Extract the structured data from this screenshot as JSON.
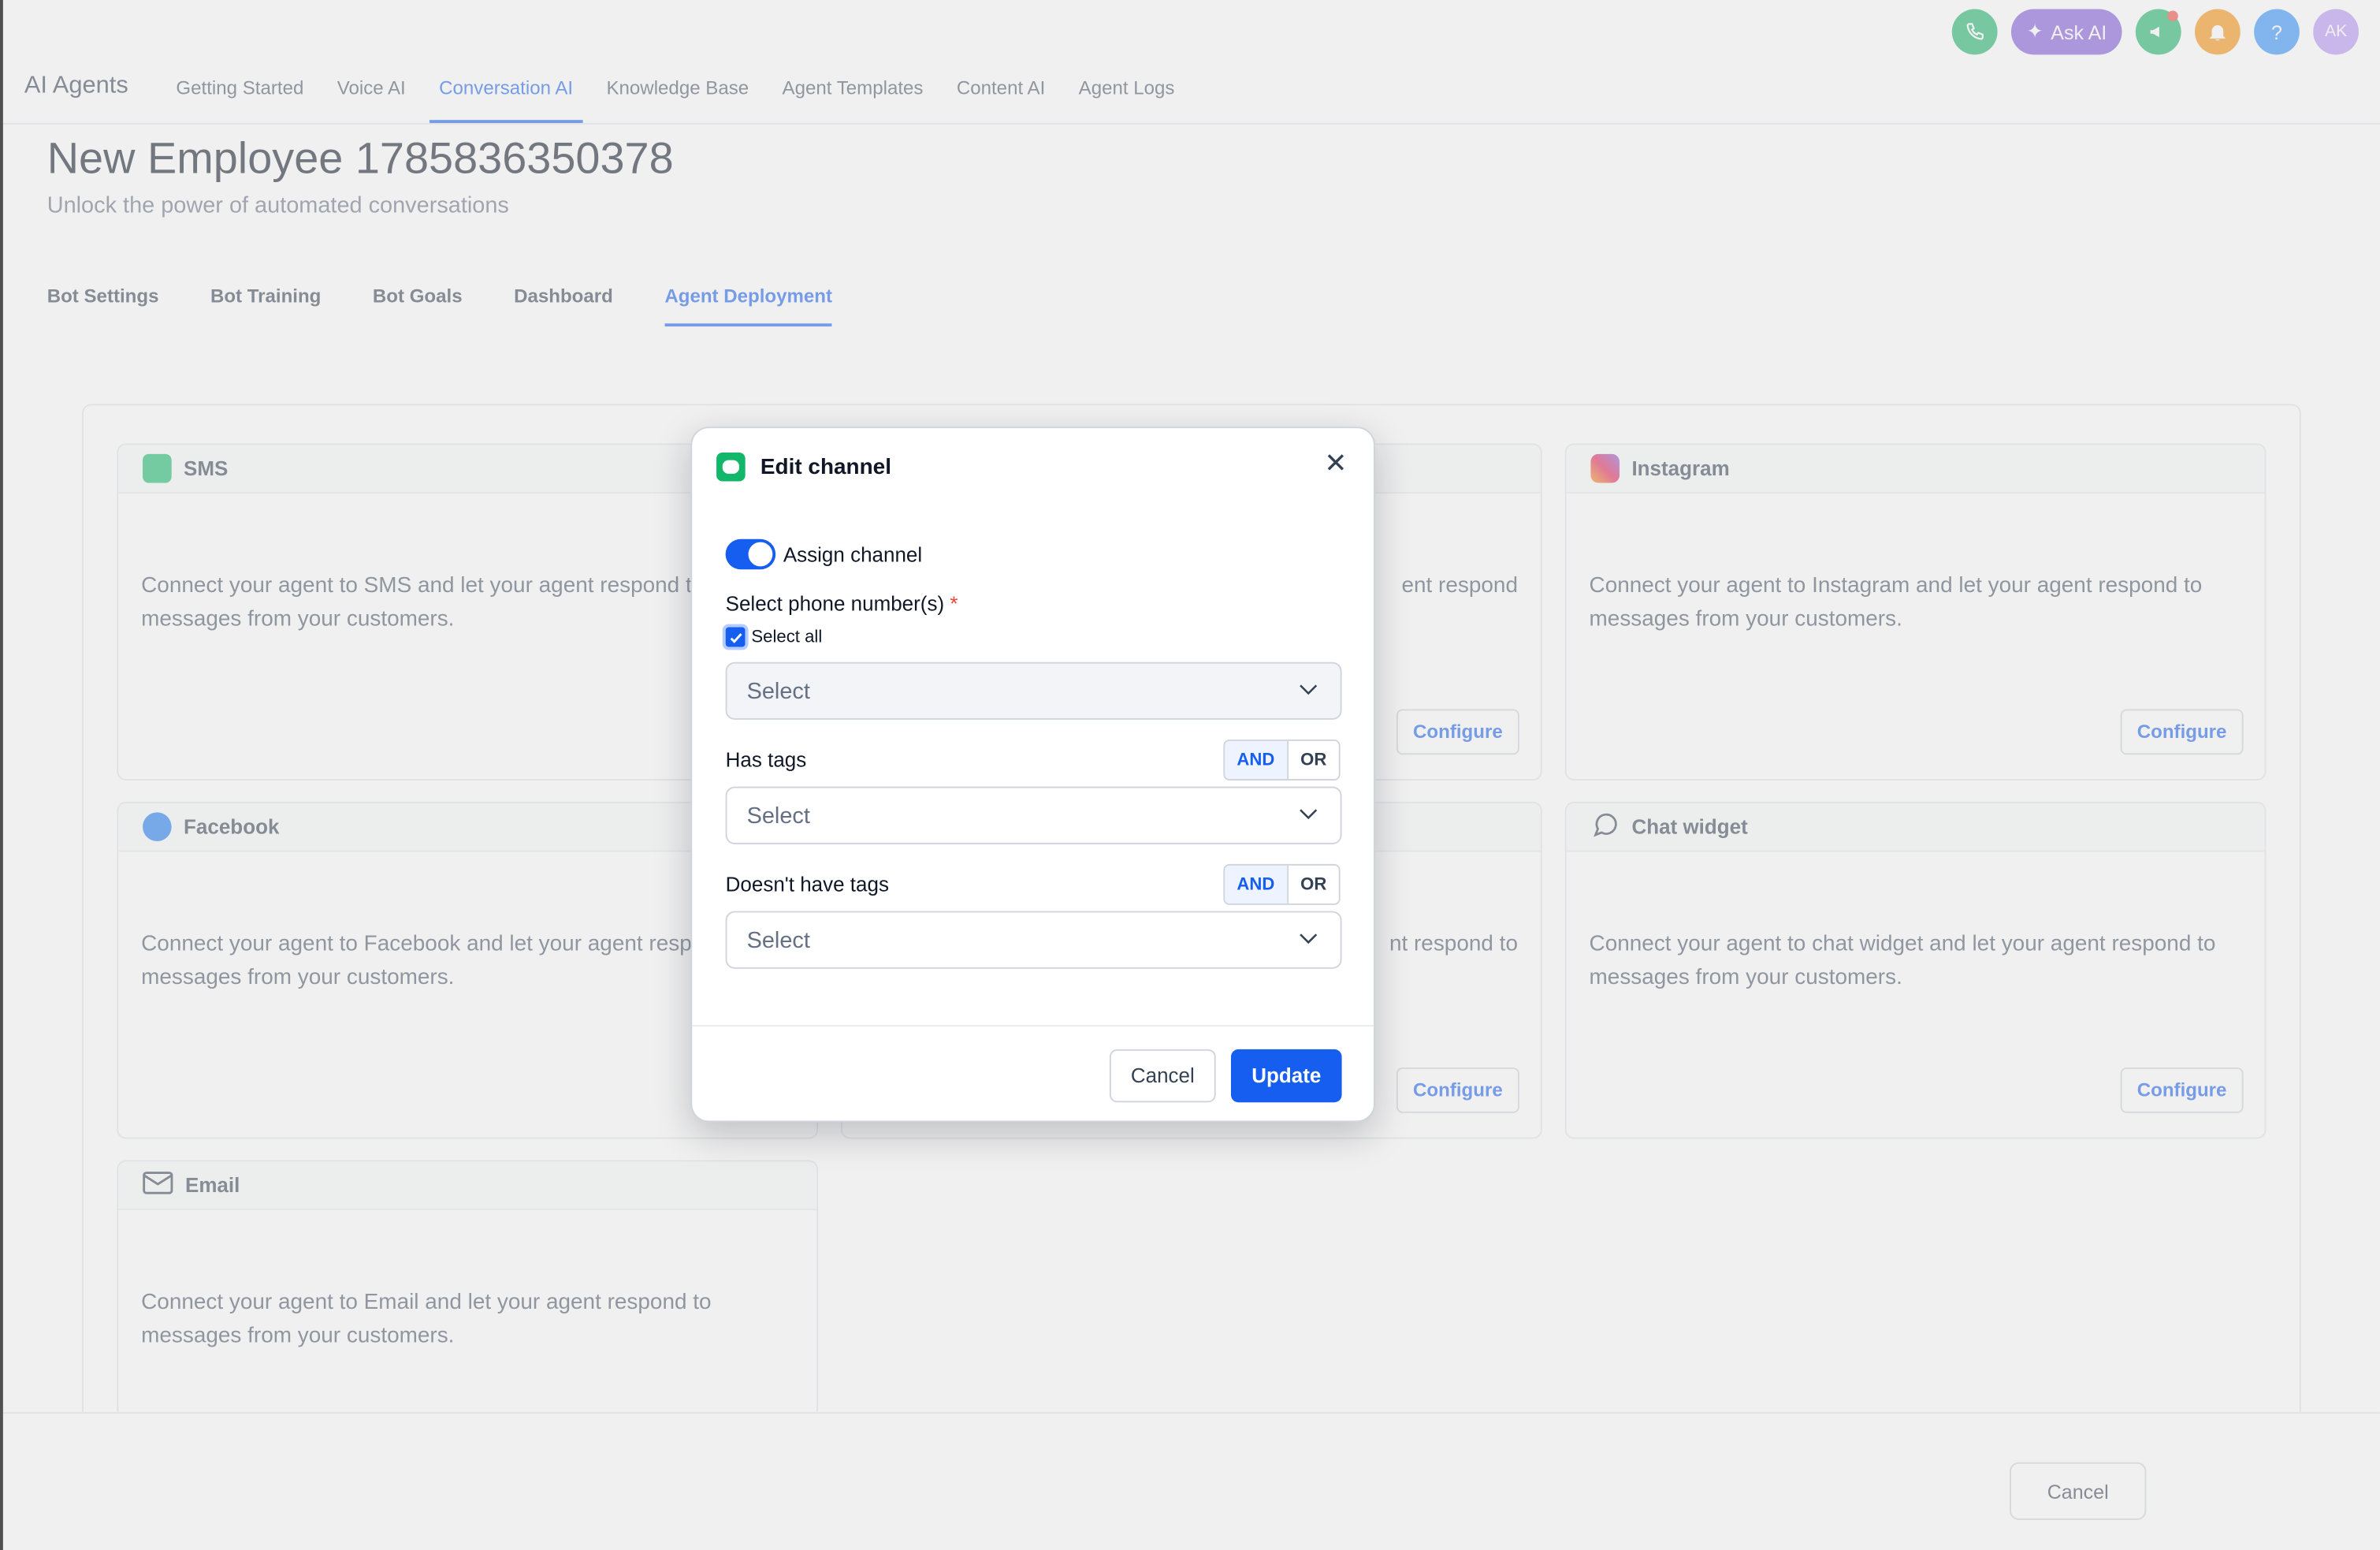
{
  "app": {
    "brand": "AI Agents"
  },
  "nav": {
    "tabs": [
      "Getting Started",
      "Voice AI",
      "Conversation AI",
      "Knowledge Base",
      "Agent Templates",
      "Content AI",
      "Agent Logs"
    ],
    "active": "Conversation AI",
    "ask_ai": "Ask AI",
    "avatar_initials": "AK",
    "help": "?"
  },
  "page": {
    "title": "New Employee 1785836350378",
    "subtitle": "Unlock the power of automated conversations",
    "subtabs": [
      "Bot Settings",
      "Bot Training",
      "Bot Goals",
      "Dashboard",
      "Agent Deployment"
    ],
    "active_subtab": "Agent Deployment"
  },
  "channels": {
    "sms": {
      "title": "SMS",
      "desc": "Connect your agent to SMS and let your agent respond to messages from your customers."
    },
    "instagram": {
      "title": "Instagram",
      "desc": "Connect your agent to Instagram and let your agent respond to messages from your customers.",
      "button": "Configure"
    },
    "facebook": {
      "title": "Facebook",
      "desc": "Connect your agent to Facebook and let your agent respond to messages from your customers."
    },
    "chat_widget": {
      "title": "Chat widget",
      "desc": "Connect your agent to chat widget and let your agent respond to messages from your customers.",
      "button": "Configure"
    },
    "email": {
      "title": "Email",
      "desc": "Connect your agent to Email and let your agent respond to messages from your customers."
    },
    "middle_top": {
      "desc_fragment": "ent respond",
      "button": "Configure"
    },
    "middle_bottom": {
      "desc_fragment": "nt respond to",
      "button": "Configure"
    }
  },
  "footer": {
    "cancel": "Cancel"
  },
  "modal": {
    "title": "Edit channel",
    "assign_label": "Assign channel",
    "assign_on": true,
    "phone_label": "Select phone number(s)",
    "required_mark": "*",
    "select_all": "Select all",
    "select_all_checked": true,
    "phone_placeholder": "Select",
    "has_tags_label": "Has tags",
    "has_tags_placeholder": "Select",
    "no_tags_label": "Doesn't have tags",
    "no_tags_placeholder": "Select",
    "and": "AND",
    "or": "OR",
    "cancel": "Cancel",
    "update": "Update"
  },
  "colors": {
    "primary": "#155eef",
    "sms_green": "#12b76a"
  }
}
